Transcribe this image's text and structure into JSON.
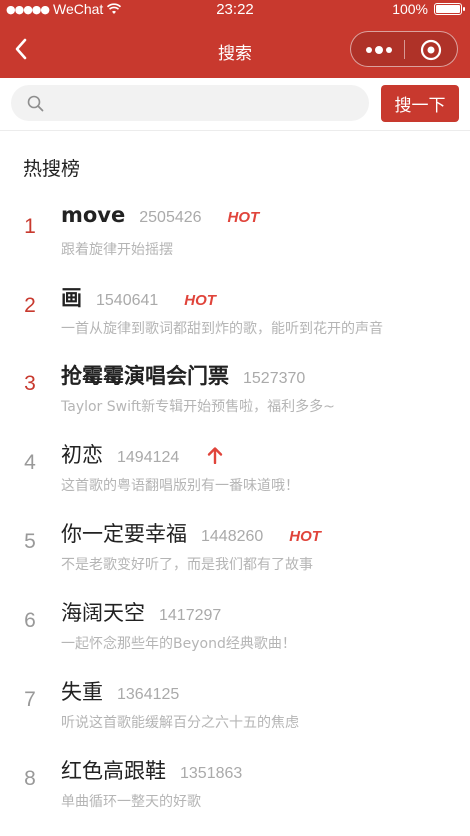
{
  "status_bar": {
    "signal": "●●●●●",
    "carrier": "WeChat",
    "time": "23:22",
    "battery": "100%"
  },
  "nav": {
    "title": "搜索"
  },
  "search": {
    "placeholder": "",
    "button_label": "搜一下"
  },
  "hot_list": {
    "title": "热搜榜",
    "items": [
      {
        "rank": "1",
        "name": "move",
        "count": "2505426",
        "badge": "HOT",
        "desc": "跟着旋律开始摇摆"
      },
      {
        "rank": "2",
        "name": "画",
        "count": "1540641",
        "badge": "HOT",
        "desc": "一首从旋律到歌词都甜到炸的歌，能听到花开的声音"
      },
      {
        "rank": "3",
        "name": "抢霉霉演唱会门票",
        "count": "1527370",
        "badge": "",
        "desc": "Taylor Swift新专辑开始预售啦，福利多多~"
      },
      {
        "rank": "4",
        "name": "初恋",
        "count": "1494124",
        "badge": "up-arrow",
        "desc": "这首歌的粤语翻唱版别有一番味道哦！"
      },
      {
        "rank": "5",
        "name": "你一定要幸福",
        "count": "1448260",
        "badge": "HOT",
        "desc": "不是老歌变好听了，而是我们都有了故事"
      },
      {
        "rank": "6",
        "name": "海阔天空",
        "count": "1417297",
        "badge": "",
        "desc": "一起怀念那些年的Beyond经典歌曲！"
      },
      {
        "rank": "7",
        "name": "失重",
        "count": "1364125",
        "badge": "",
        "desc": "听说这首歌能缓解百分之六十五的焦虑"
      },
      {
        "rank": "8",
        "name": "红色高跟鞋",
        "count": "1351863",
        "badge": "",
        "desc": "单曲循环一整天的好歌"
      }
    ]
  },
  "colors": {
    "brand": "#c8392e",
    "hot": "#e0443b",
    "muted": "#aaaaaa"
  }
}
